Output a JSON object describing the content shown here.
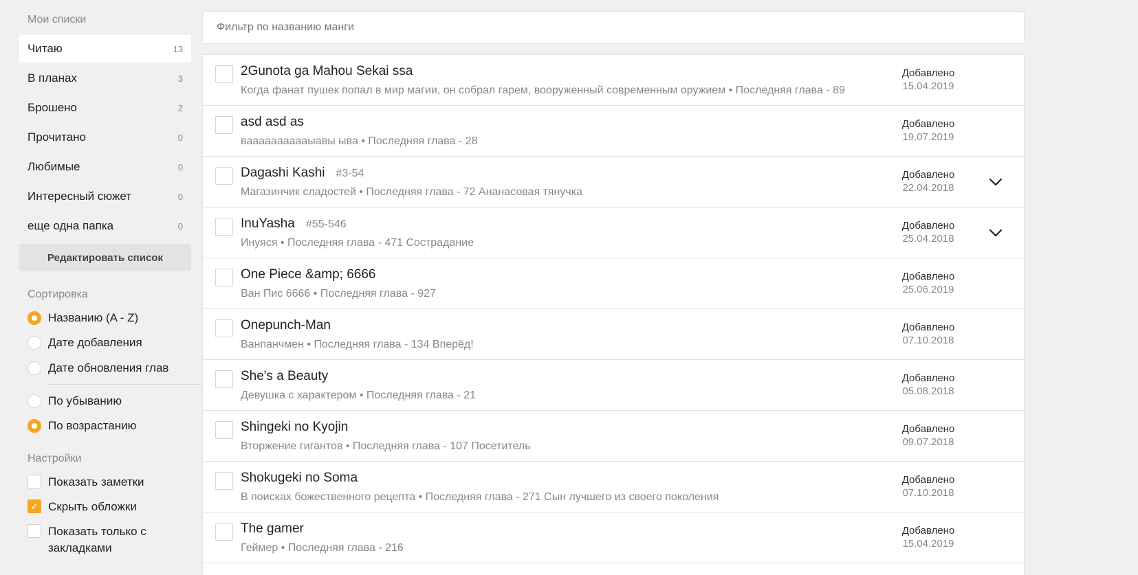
{
  "sidebar": {
    "lists_title": "Мои списки",
    "lists": [
      {
        "label": "Читаю",
        "count": "13"
      },
      {
        "label": "В планах",
        "count": "3"
      },
      {
        "label": "Брошено",
        "count": "2"
      },
      {
        "label": "Прочитано",
        "count": "0"
      },
      {
        "label": "Любимые",
        "count": "0"
      },
      {
        "label": "Интересный сюжет",
        "count": "0"
      },
      {
        "label": "еще одна папка",
        "count": "0"
      }
    ],
    "edit_button": "Редактировать список",
    "sort_title": "Сортировка",
    "sort_options": [
      {
        "label": "Названию (A - Z)",
        "selected": true
      },
      {
        "label": "Дате добавления",
        "selected": false
      },
      {
        "label": "Дате обновления глав",
        "selected": false
      }
    ],
    "order_options": [
      {
        "label": "По убыванию",
        "selected": false
      },
      {
        "label": "По возрастанию",
        "selected": true
      }
    ],
    "settings_title": "Настройки",
    "settings": [
      {
        "label": "Показать заметки",
        "checked": false
      },
      {
        "label": "Скрыть обложки",
        "checked": true
      },
      {
        "label": "Показать только с закладками",
        "checked": false
      }
    ]
  },
  "filter": {
    "placeholder": "Фильтр по названию манги"
  },
  "manga": [
    {
      "title": "2Gunota ga Mahou Sekai ssa",
      "tag": "",
      "subtitle": "Когда фанат пушек попал в мир магии, он собрал гарем, вооруженный современным оружием • Последняя глава - 89",
      "added_label": "Добавлено",
      "date": "15.04.2019",
      "expandable": false
    },
    {
      "title": "asd asd as",
      "tag": "",
      "subtitle": "вааааааааааыавы ыва • Последняя глава - 28",
      "added_label": "Добавлено",
      "date": "19.07.2019",
      "expandable": false
    },
    {
      "title": "Dagashi Kashi",
      "tag": "#3-54",
      "subtitle": "Магазинчик сладостей • Последняя глава - 72 Ананасовая тянучка",
      "added_label": "Добавлено",
      "date": "22.04.2018",
      "expandable": true
    },
    {
      "title": "InuYasha",
      "tag": "#55-546",
      "subtitle": "Инуяся • Последняя глава - 471 Сострадание",
      "added_label": "Добавлено",
      "date": "25.04.2018",
      "expandable": true
    },
    {
      "title": "One Piece &amp; 6666",
      "tag": "",
      "subtitle": "Ван Пис 6666 • Последняя глава - 927",
      "added_label": "Добавлено",
      "date": "25.06.2019",
      "expandable": false
    },
    {
      "title": "Onepunch-Man",
      "tag": "",
      "subtitle": "Ванпанчмен • Последняя глава - 134 Вперёд!",
      "added_label": "Добавлено",
      "date": "07.10.2018",
      "expandable": false
    },
    {
      "title": "She's a Beauty",
      "tag": "",
      "subtitle": "Девушка с характером • Последняя глава - 21",
      "added_label": "Добавлено",
      "date": "05.08.2018",
      "expandable": false
    },
    {
      "title": "Shingeki no Kyojin",
      "tag": "",
      "subtitle": "Вторжение гигантов • Последняя глава - 107 Посетитель",
      "added_label": "Добавлено",
      "date": "09.07.2018",
      "expandable": false
    },
    {
      "title": "Shokugeki no Soma",
      "tag": "",
      "subtitle": "В поисках божественного рецепта • Последняя глава - 271 Сын лучшего из своего поколения",
      "added_label": "Добавлено",
      "date": "07.10.2018",
      "expandable": false
    },
    {
      "title": "The gamer",
      "tag": "",
      "subtitle": "Геймер • Последняя глава - 216",
      "added_label": "Добавлено",
      "date": "15.04.2019",
      "expandable": false
    }
  ],
  "colors": {
    "accent": "#f5a623",
    "background": "#f0f0f0"
  }
}
